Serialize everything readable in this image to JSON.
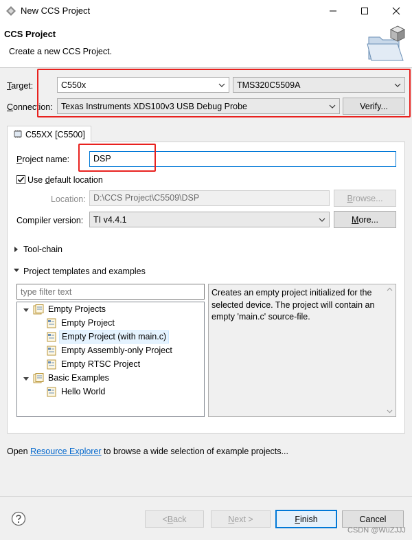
{
  "window": {
    "title": "New CCS Project"
  },
  "header": {
    "title": "CCS Project",
    "description": "Create a new CCS Project."
  },
  "target": {
    "label_prefix": "",
    "label_mnemonic": "T",
    "label_rest": "arget:",
    "family": "C550x",
    "device": "TMS320C5509A"
  },
  "connection": {
    "label_mnemonic": "C",
    "label_rest": "onnection:",
    "value": "Texas Instruments XDS100v3 USB Debug Probe",
    "verify_label": "Verify..."
  },
  "tab": {
    "label": "C55XX [C5500]"
  },
  "project": {
    "name_label_mnemonic": "P",
    "name_label_rest": "roject name:",
    "name_value": "DSP",
    "default_location_label_pre": "Use ",
    "default_location_label_mnemonic": "d",
    "default_location_label_post": "efault location",
    "default_location_checked": true,
    "location_label": "Location:",
    "location_value": "D:\\CCS Project\\C5509\\DSP",
    "browse_label_mnemonic": "B",
    "browse_label_rest": "rowse...",
    "compiler_label": "Compiler version:",
    "compiler_value": "TI v4.4.1",
    "more_label_mnemonic": "M",
    "more_label_rest": "ore..."
  },
  "sections": {
    "toolchain": "Tool-chain",
    "templates": "Project templates and examples"
  },
  "templates": {
    "filter_placeholder": "type filter text",
    "tree": {
      "group1": "Empty Projects",
      "item1": "Empty Project",
      "item2": "Empty Project (with main.c)",
      "item3": "Empty Assembly-only Project",
      "item4": "Empty RTSC Project",
      "group2": "Basic Examples",
      "item5": "Hello World"
    },
    "description": "Creates an empty project initialized for the selected device. The project will contain an empty 'main.c' source-file."
  },
  "footer": {
    "open_text": "Open ",
    "link_text": "Resource Explorer",
    "rest_text": " to browse a wide selection of example projects...",
    "back_label_pre": "< ",
    "back_label_mnemonic": "B",
    "back_label_rest": "ack",
    "next_label_mnemonic": "N",
    "next_label_rest": "ext >",
    "finish_label_mnemonic": "F",
    "finish_label_rest": "inish",
    "cancel_label": "Cancel"
  },
  "watermark": "CSDN @WuZJJJ",
  "colors": {
    "accent": "#0078d7",
    "highlight_box": "#e8211e",
    "link": "#0066cc"
  }
}
